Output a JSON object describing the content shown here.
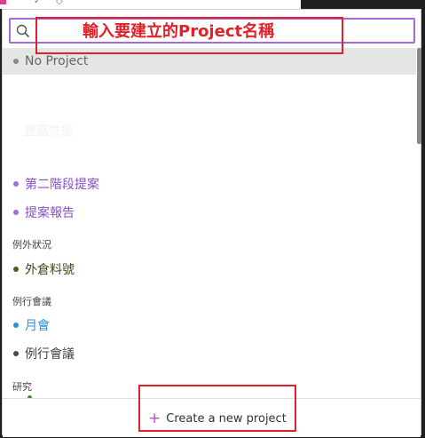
{
  "search": {
    "placeholder": "",
    "value": ""
  },
  "annotations": {
    "project_name_hint": "輸入要建立的Project名稱"
  },
  "projects": {
    "no_project": {
      "label": "No Project",
      "color": "#888888"
    },
    "faded_item": "豐富性能",
    "items": [
      {
        "label": "第二階段提案",
        "color": "#a46bd8"
      },
      {
        "label": "提案報告",
        "color": "#a46bd8"
      }
    ],
    "groups": [
      {
        "header": "例外狀況",
        "items": [
          {
            "label": "外倉料號",
            "color": "#4e5a1f"
          }
        ]
      },
      {
        "header": "例行會議",
        "items": [
          {
            "label": "月會",
            "color": "#2f8fd6"
          },
          {
            "label": "例行會議",
            "color": "#4a4a4a"
          }
        ]
      },
      {
        "header": "研究",
        "items": []
      }
    ]
  },
  "footer": {
    "create_label": "Create a new project",
    "accent_color": "#c24bd3"
  },
  "colors": {
    "search_border": "#a56ad9",
    "annotation": "#e0202a",
    "selected_row_bg": "#e5e5e5"
  }
}
